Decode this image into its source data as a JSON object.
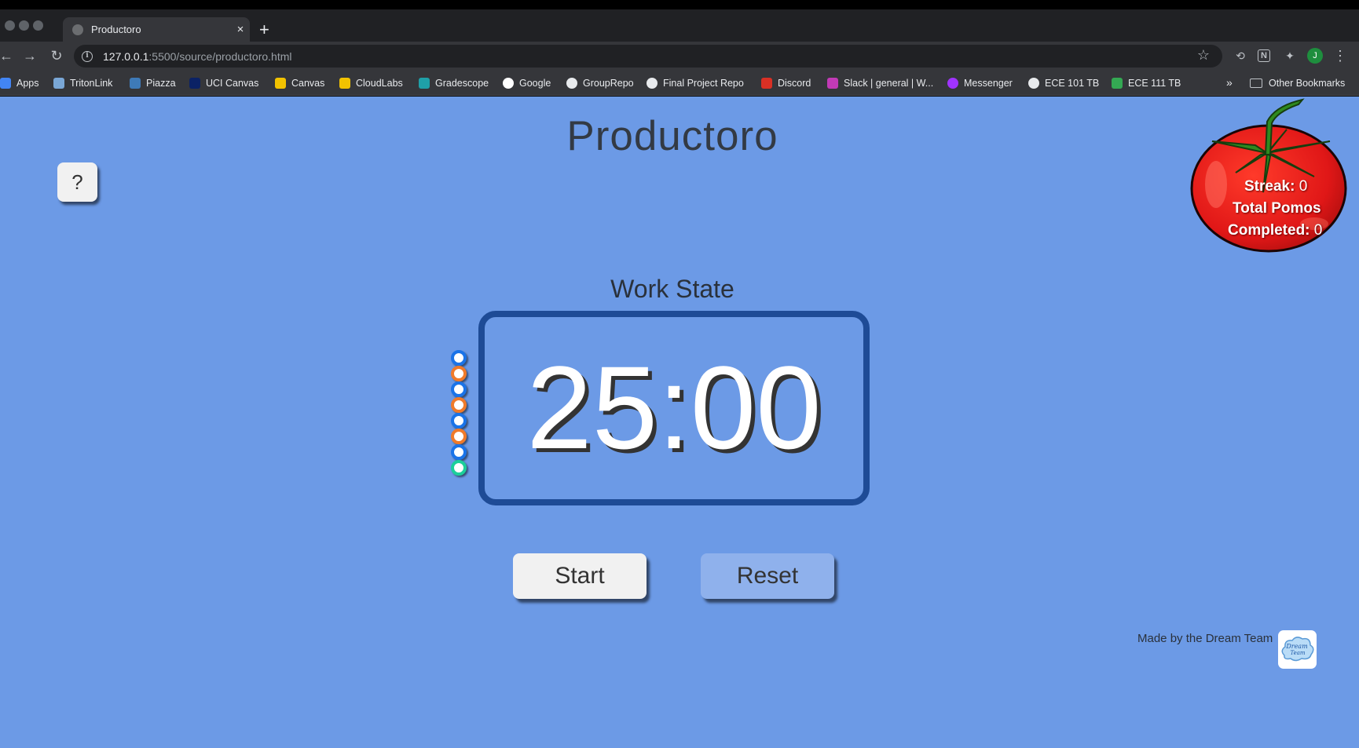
{
  "browser": {
    "tab_title": "Productoro",
    "tab_close": "×",
    "new_tab": "+",
    "url_host": "127.0.0.1",
    "url_path": ":5500/source/productoro.html",
    "profile_initial": "J",
    "bookmarks": [
      {
        "label": "Apps",
        "icon": "apps-grid-icon",
        "color": "#4285f4"
      },
      {
        "label": "TritonLink",
        "icon": "tritonlink-icon",
        "color": "#7aa7d6"
      },
      {
        "label": "Piazza",
        "icon": "piazza-icon",
        "color": "#3e7ab8"
      },
      {
        "label": "UCI Canvas",
        "icon": "uci-canvas-icon",
        "color": "#0b2265"
      },
      {
        "label": "Canvas",
        "icon": "canvas-icon",
        "color": "#f2c200"
      },
      {
        "label": "CloudLabs",
        "icon": "cloudlabs-icon",
        "color": "#f2c200"
      },
      {
        "label": "Gradescope",
        "icon": "gradescope-icon",
        "color": "#1fa0a8"
      },
      {
        "label": "Google",
        "icon": "google-icon",
        "color": "#ffffff"
      },
      {
        "label": "GroupRepo",
        "icon": "github-icon",
        "color": "#e8eaed"
      },
      {
        "label": "Final Project Repo",
        "icon": "github-icon",
        "color": "#e8eaed"
      },
      {
        "label": "Discord",
        "icon": "calendar-icon",
        "color": "#d93025"
      },
      {
        "label": "Slack | general | W...",
        "icon": "slack-icon",
        "color": "#c23ab6"
      },
      {
        "label": "Messenger",
        "icon": "messenger-icon",
        "color": "#a033ff"
      },
      {
        "label": "ECE 101 TB",
        "icon": "globe-icon",
        "color": "#e8eaed"
      },
      {
        "label": "ECE 111 TB",
        "icon": "drive-icon",
        "color": "#34a853"
      }
    ],
    "more_bookmarks": "»",
    "other_bookmarks": "Other Bookmarks"
  },
  "app": {
    "title": "Productoro",
    "help_label": "?",
    "stats": {
      "streak_label": "Streak:",
      "streak_value": "0",
      "total_label_1": "Total Pomos",
      "total_label_2": "Completed:",
      "total_value": "0"
    },
    "state_label": "Work State",
    "timer": "25:00",
    "session_dots": [
      {
        "type": "work",
        "color": "#1a73e8"
      },
      {
        "type": "break",
        "color": "#f07a2a"
      },
      {
        "type": "work",
        "color": "#1a73e8"
      },
      {
        "type": "break",
        "color": "#f07a2a"
      },
      {
        "type": "work",
        "color": "#1a73e8"
      },
      {
        "type": "break",
        "color": "#f07a2a"
      },
      {
        "type": "work",
        "color": "#1a73e8"
      },
      {
        "type": "long-break",
        "color": "#1ccf9b"
      }
    ],
    "start_label": "Start",
    "reset_label": "Reset",
    "credit": "Made by the Dream Team",
    "logo_text_1": "Dream",
    "logo_text_2": "Team"
  },
  "colors": {
    "page_bg": "#6c9ae6",
    "timer_border": "#1e4b96",
    "tomato_red": "#e01717",
    "leaf_green": "#2f8a1f"
  }
}
